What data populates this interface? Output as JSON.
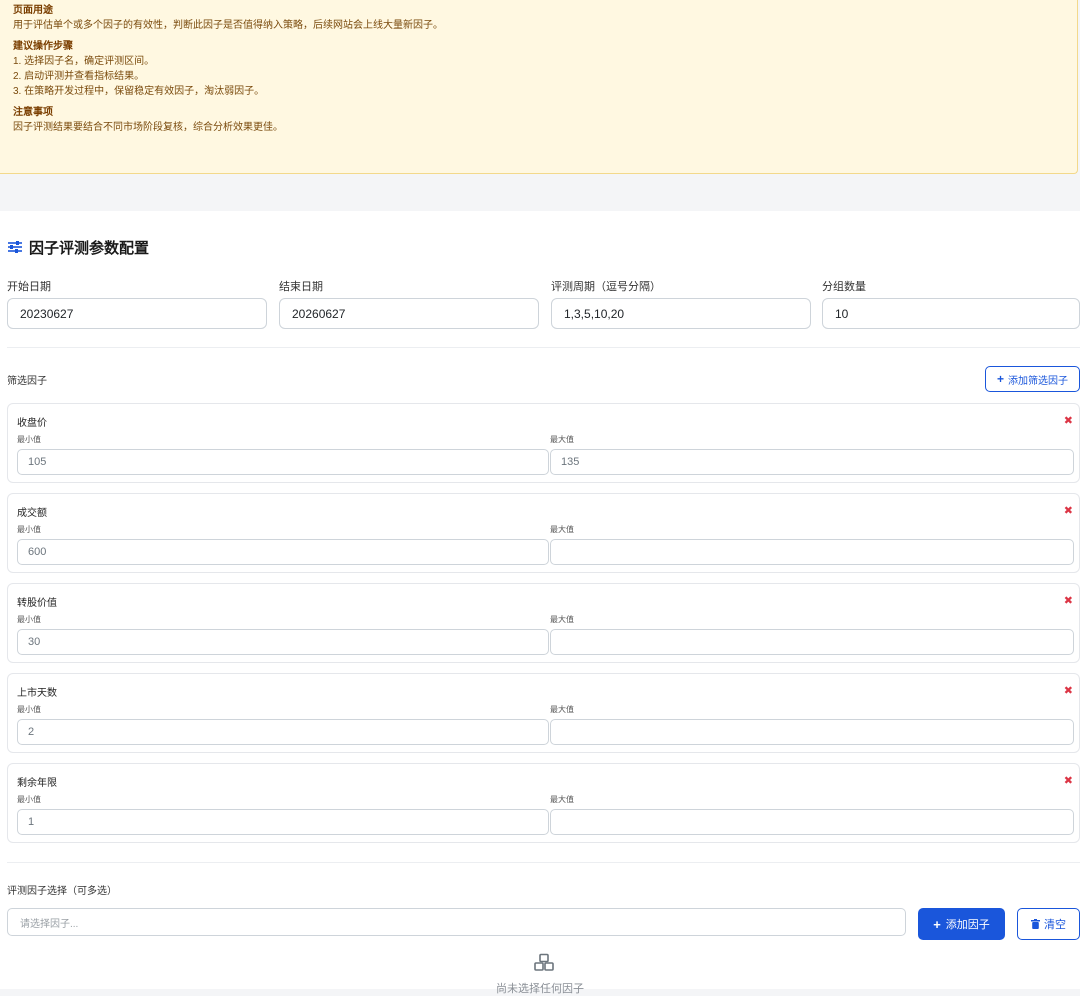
{
  "notice": {
    "purpose_title": "页面用途",
    "purpose_text": "用于评估单个或多个因子的有效性，判断此因子是否值得纳入策略，后续网站会上线大量新因子。",
    "steps_title": "建议操作步骤",
    "steps": [
      "1. 选择因子名，确定评测区间。",
      "2. 启动评测并查看指标结果。",
      "3. 在策略开发过程中，保留稳定有效因子，淘汰弱因子。"
    ],
    "notes_title": "注意事项",
    "notes_text": "因子评测结果要结合不同市场阶段复核，综合分析效果更佳。"
  },
  "config": {
    "title": "因子评测参数配置",
    "start_label": "开始日期",
    "start_value": "20230627",
    "end_label": "结束日期",
    "end_value": "20260627",
    "period_label": "评测周期（逗号分隔）",
    "period_value": "1,3,5,10,20",
    "groups_label": "分组数量",
    "groups_value": "10"
  },
  "filters": {
    "label": "筛选因子",
    "add_button": "添加筛选因子",
    "min_label": "最小值",
    "max_label": "最大值",
    "items": [
      {
        "name": "收盘价",
        "min": "105",
        "max": "135"
      },
      {
        "name": "成交额",
        "min": "600",
        "max": ""
      },
      {
        "name": "转股价值",
        "min": "30",
        "max": ""
      },
      {
        "name": "上市天数",
        "min": "2",
        "max": ""
      },
      {
        "name": "剩余年限",
        "min": "1",
        "max": ""
      }
    ]
  },
  "factor_select": {
    "label": "评测因子选择（可多选）",
    "placeholder": "请选择因子...",
    "add_button": "添加因子",
    "clear_button": "清空",
    "empty_text": "尚未选择任何因子"
  },
  "colors": {
    "accent": "#1a56db",
    "danger": "#dc3545",
    "notice_bg": "#fff8e1"
  }
}
